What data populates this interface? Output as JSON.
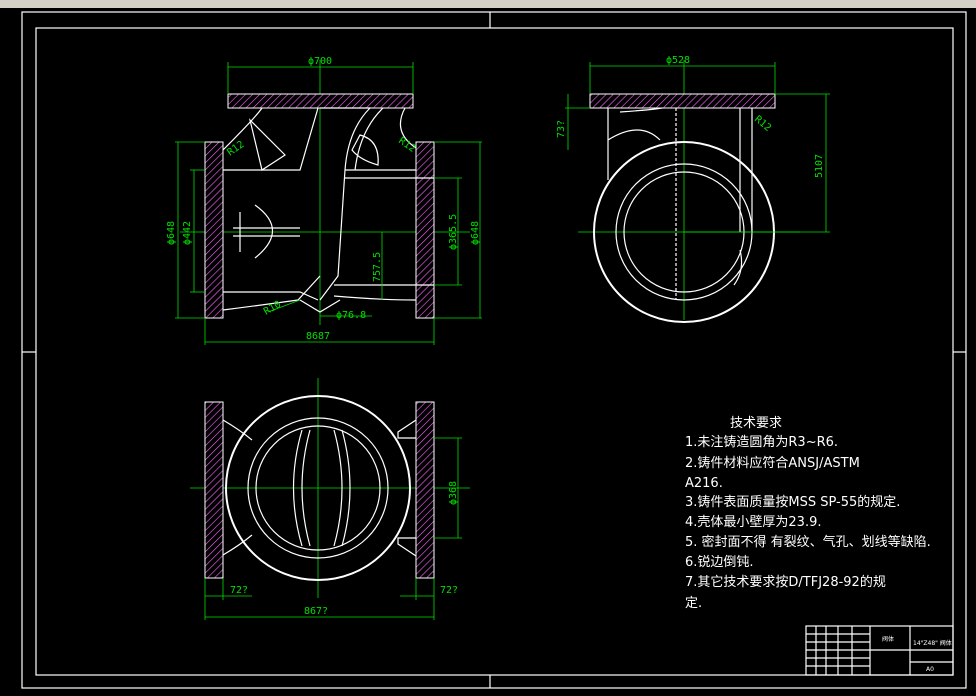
{
  "views": {
    "front": {
      "dims": {
        "top_dia": "ϕ700",
        "r_left": "R12",
        "r_right": "R12",
        "outer_left": "ϕ648",
        "inner_left": "ϕ442",
        "outer_right": "ϕ648",
        "inner_right": "ϕ365.5",
        "height_mid": "757.5",
        "r_bottom": "R10",
        "bottom_dia": "ϕ76.8",
        "overall_length": "8687"
      }
    },
    "side": {
      "dims": {
        "top_dia": "ϕ528",
        "left_dim": "73?",
        "r_top": "R12",
        "height_right": "5107"
      }
    },
    "plan": {
      "dims": {
        "dia_right": "ϕ368",
        "left_72": "72?",
        "right_72": "72?",
        "overall": "867?"
      }
    }
  },
  "notes": {
    "title": "技术要求",
    "items": [
      "1.未注铸造圆角为R3~R6.",
      "2.铸件材料应符合ANSJ/ASTM",
      "A216.",
      "3.铸件表面质量按MSS SP-55的规定.",
      "4.壳体最小壁厚为23.9.",
      "5.  密封面不得 有裂纹、气孔、划线等缺陷.",
      "6.锐边倒钝.",
      "7.其它技术要求按D/TFJ28-92的规",
      "定."
    ]
  },
  "title_block": {
    "name": "阀体",
    "drawing": "14\"Z48\" 阀体",
    "scale": "A0"
  }
}
